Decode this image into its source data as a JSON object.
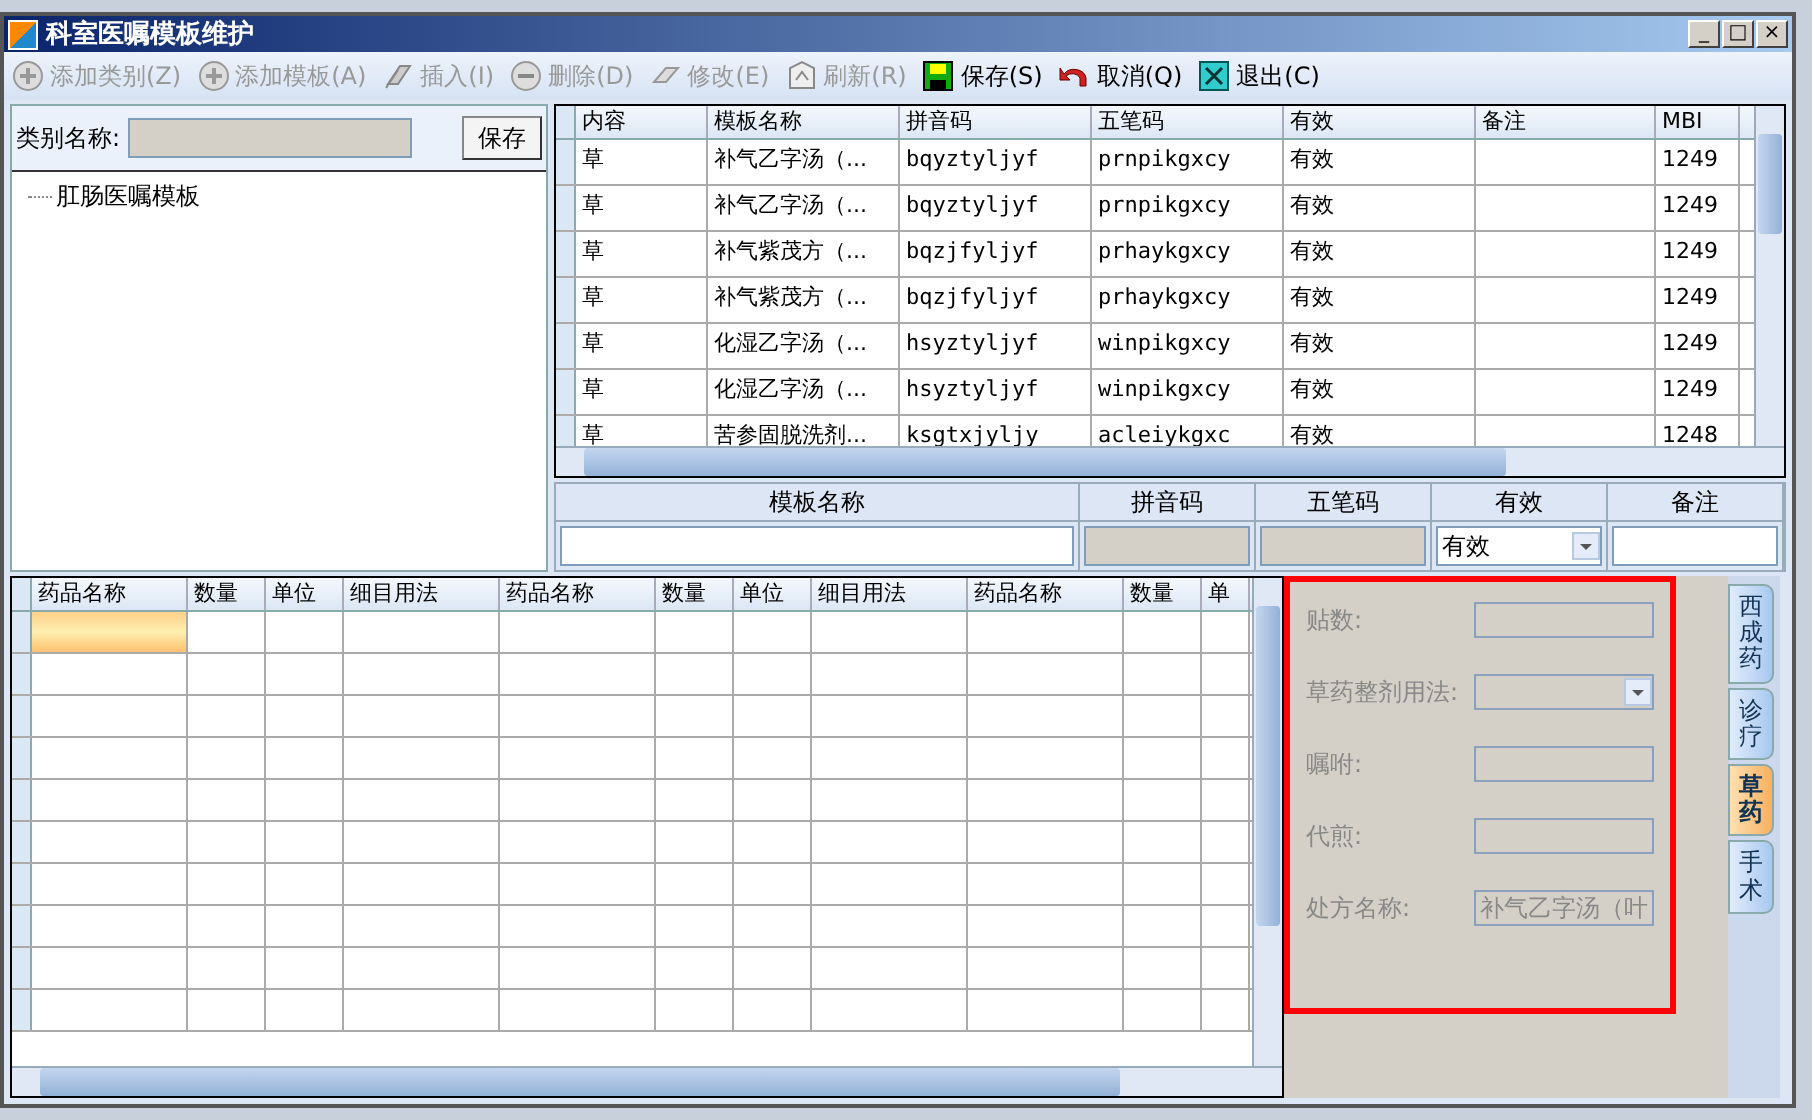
{
  "window": {
    "title": "科室医嘱模板维护",
    "controls": [
      "_",
      "□",
      "×"
    ]
  },
  "toolbar": [
    {
      "label": "添加类别(Z)",
      "disabled": true
    },
    {
      "label": "添加模板(A)",
      "disabled": true
    },
    {
      "label": "插入(I)",
      "disabled": true
    },
    {
      "label": "删除(D)",
      "disabled": true
    },
    {
      "label": "修改(E)",
      "disabled": true
    },
    {
      "label": "刷新(R)",
      "disabled": true
    },
    {
      "label": "保存(S)",
      "disabled": false
    },
    {
      "label": "取消(Q)",
      "disabled": false
    },
    {
      "label": "退出(C)",
      "disabled": false
    }
  ],
  "category": {
    "label": "类别名称:",
    "save": "保存",
    "tree": [
      {
        "label": "肛肠医嘱模板"
      }
    ]
  },
  "template_table": {
    "columns": [
      "内容",
      "模板名称",
      "拼音码",
      "五笔码",
      "有效",
      "备注",
      "MBI"
    ],
    "rows": [
      [
        "草",
        "补气乙字汤（...",
        "bqyztyljyf",
        "prnpikgxcy",
        "有效",
        "",
        "1249"
      ],
      [
        "草",
        "补气乙字汤（...",
        "bqyztyljyf",
        "prnpikgxcy",
        "有效",
        "",
        "1249"
      ],
      [
        "草",
        "补气紫茂方（...",
        "bqzjfyljyf",
        "prhaykgxcy",
        "有效",
        "",
        "1249"
      ],
      [
        "草",
        "补气紫茂方（...",
        "bqzjfyljyf",
        "prhaykgxcy",
        "有效",
        "",
        "1249"
      ],
      [
        "草",
        "化湿乙字汤（...",
        "hsyztyljyf",
        "winpikgxcy",
        "有效",
        "",
        "1249"
      ],
      [
        "草",
        "化湿乙字汤（...",
        "hsyztyljyf",
        "winpikgxcy",
        "有效",
        "",
        "1249"
      ],
      [
        "草",
        "苦参固脱洗剂...",
        "ksgtxjyljy",
        "acleiykgxc",
        "有效",
        "",
        "1248"
      ]
    ]
  },
  "template_form": [
    {
      "label": "模板名称",
      "kind": "text",
      "disabled": false
    },
    {
      "label": "拼音码",
      "kind": "text",
      "disabled": true
    },
    {
      "label": "五笔码",
      "kind": "text",
      "disabled": true
    },
    {
      "label": "有效",
      "kind": "select",
      "value": "有效",
      "disabled": false
    },
    {
      "label": "备注",
      "kind": "text",
      "disabled": false
    }
  ],
  "drug_table": {
    "columns": [
      "药品名称",
      "数量",
      "单位",
      "细目用法",
      "药品名称",
      "数量",
      "单位",
      "细目用法",
      "药品名称",
      "数量",
      "单"
    ]
  },
  "herb_panel": {
    "fields": [
      {
        "label": "贴数:",
        "kind": "text"
      },
      {
        "label": "草药整剂用法:",
        "kind": "select"
      },
      {
        "label": "嘱咐:",
        "kind": "text"
      },
      {
        "label": "代煎:",
        "kind": "text"
      },
      {
        "label": "处方名称:",
        "kind": "text",
        "value": "补气乙字汤（叶"
      }
    ]
  },
  "side_tabs": [
    {
      "label": "西成药",
      "selected": false
    },
    {
      "label": "诊疗",
      "selected": false
    },
    {
      "label": "草药",
      "selected": true
    },
    {
      "label": "手术",
      "selected": false
    }
  ]
}
